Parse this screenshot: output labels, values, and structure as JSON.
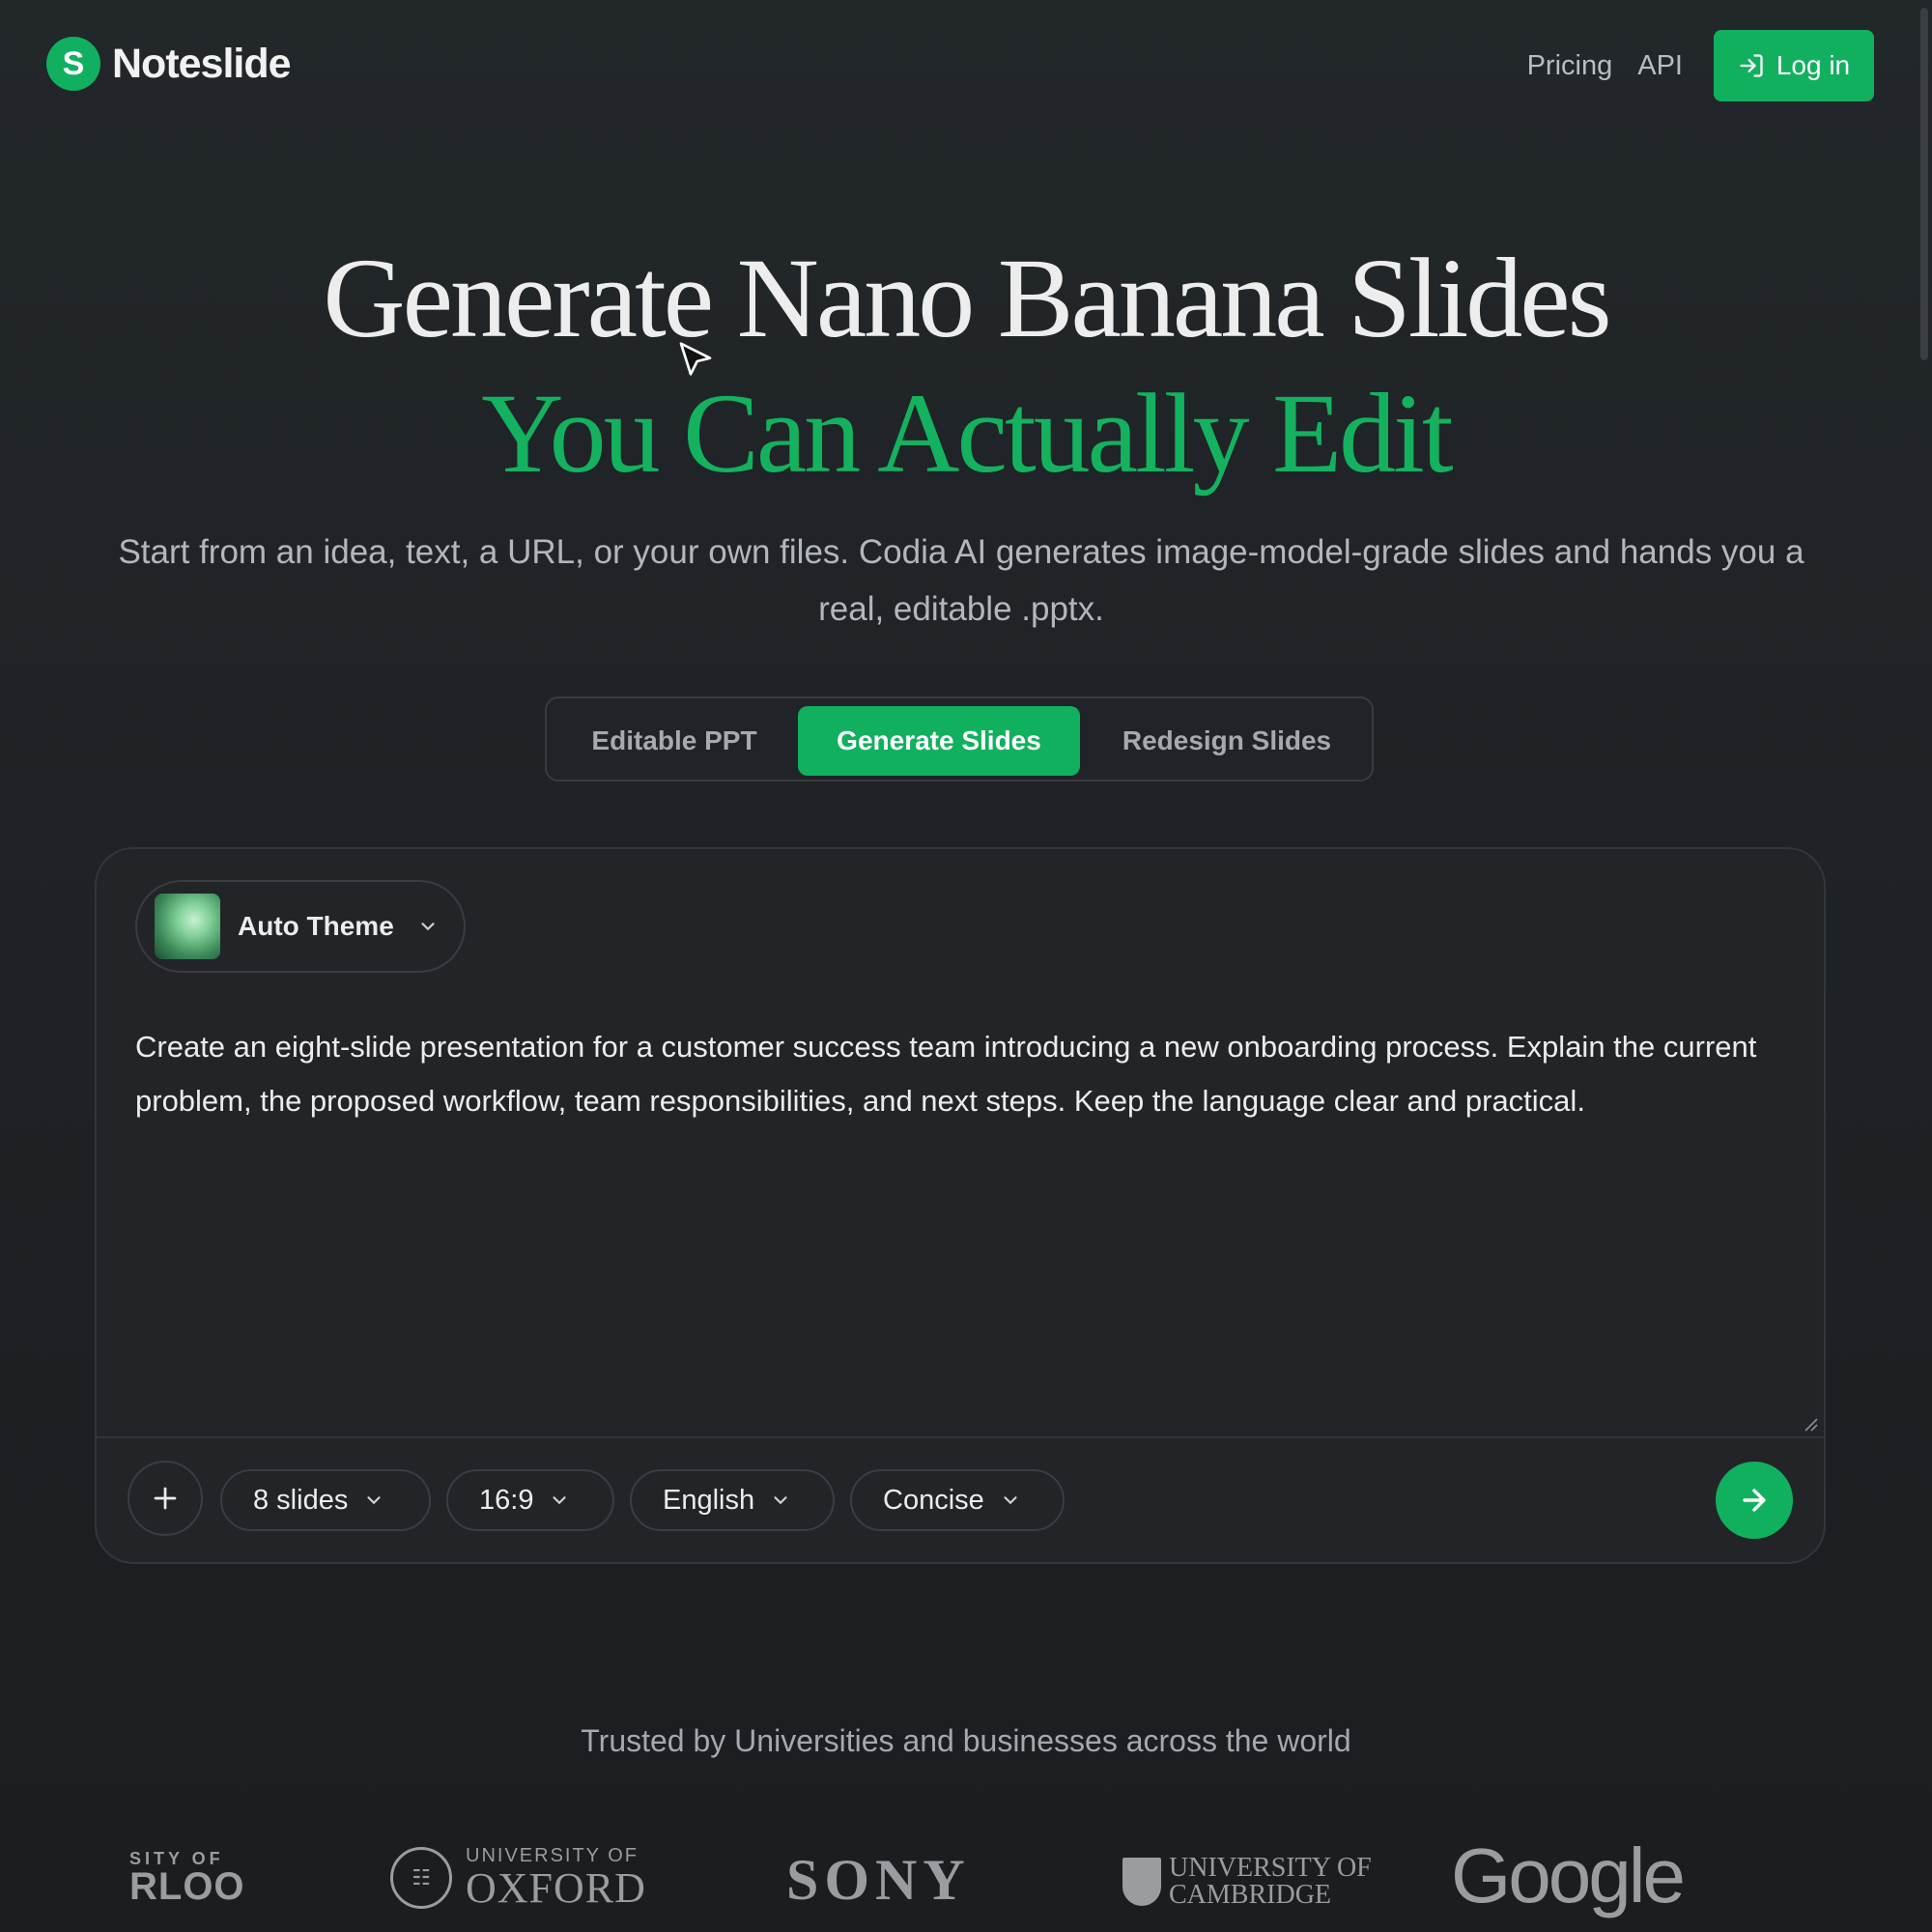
{
  "header": {
    "logo_mark": "S",
    "brand": "Noteslide",
    "nav": {
      "pricing": "Pricing",
      "api": "API",
      "login": "Log in"
    }
  },
  "hero": {
    "line1": "Generate Nano Banana Slides",
    "line2": "You Can Actually Edit",
    "subtitle": "Start from an idea, text, a URL, or your own files. Codia AI generates image-model-grade slides and hands you a real, editable .pptx."
  },
  "tabs": [
    {
      "label": "Editable PPT",
      "active": false
    },
    {
      "label": "Generate Slides",
      "active": true
    },
    {
      "label": "Redesign Slides",
      "active": false
    }
  ],
  "composer": {
    "theme": "Auto Theme",
    "prompt": "Create an eight-slide presentation for a customer success team introducing a new onboarding process. Explain the current problem, the proposed workflow, team responsibilities, and next steps. Keep the language clear and practical.",
    "options": {
      "slides": "8 slides",
      "ratio": "16:9",
      "language": "English",
      "tone": "Concise"
    }
  },
  "trusted": {
    "heading": "Trusted by Universities and businesses across the world",
    "logos": {
      "waterloo_top": "SITY OF",
      "waterloo_main": "RLOO",
      "oxford_top": "UNIVERSITY OF",
      "oxford_main": "OXFORD",
      "sony": "SONY",
      "cambridge_top": "UNIVERSITY OF",
      "cambridge_main": "CAMBRIDGE",
      "google": "Google"
    }
  },
  "colors": {
    "accent": "#11b05f",
    "background": "#202327",
    "text": "#ececec"
  }
}
